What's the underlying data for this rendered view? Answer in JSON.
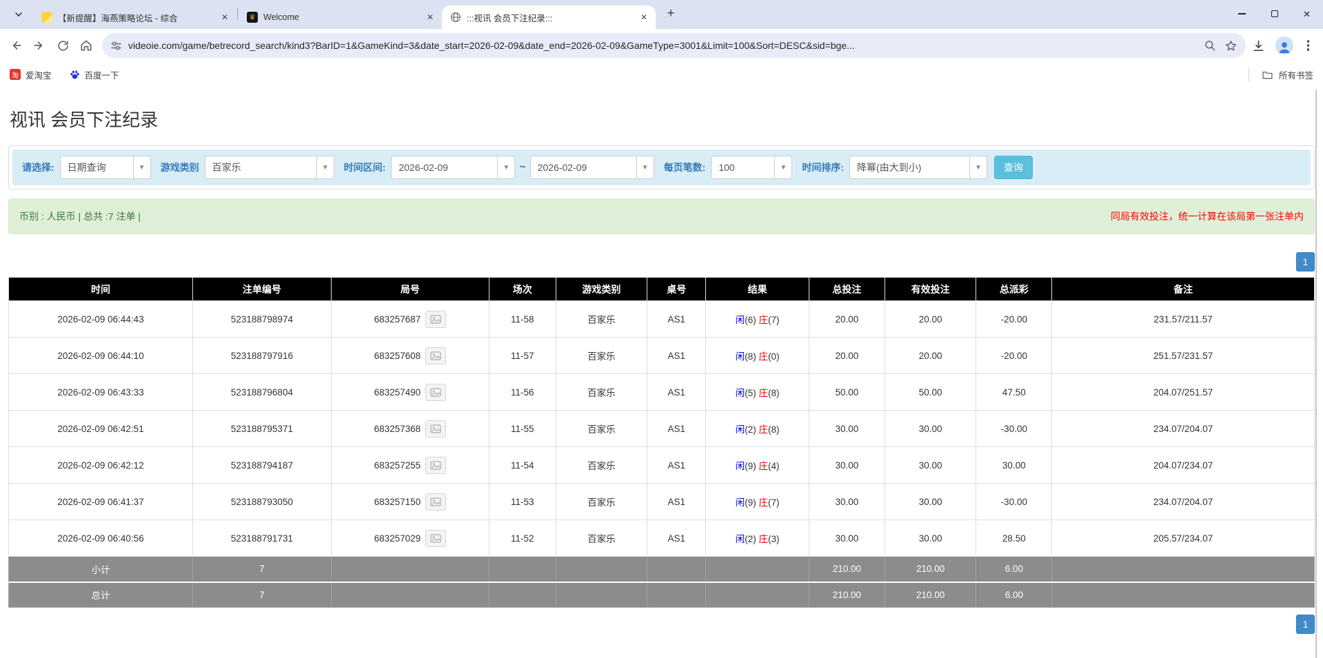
{
  "browser": {
    "tab_search_icon": "chevron-down",
    "tabs": [
      {
        "title": "【新提醒】海燕策略论坛 - 综合",
        "favicon": "yellow-doc"
      },
      {
        "title": "Welcome",
        "favicon": "dark-crest"
      },
      {
        "title": ":::视讯 会员下注纪录:::",
        "favicon": "globe"
      }
    ],
    "window_controls": [
      "minimize",
      "maximize",
      "close"
    ],
    "url": "videoie.com/game/betrecord_search/kind3?BarID=1&GameKind=3&date_start=2026-02-09&date_end=2026-02-09&GameType=3001&Limit=100&Sort=DESC&sid=bge...",
    "omnibox_icons": [
      "tune",
      "zoom",
      "star"
    ],
    "toolbar_icons": [
      "back",
      "forward",
      "reload",
      "home",
      "download",
      "profile",
      "menu"
    ],
    "bookmarks": [
      {
        "label": "爱淘宝",
        "icon": "taobao"
      },
      {
        "label": "百度一下",
        "icon": "baidu-paw"
      }
    ],
    "all_bookmarks_label": "所有书签"
  },
  "page": {
    "title": "视讯 会员下注纪录",
    "filters": {
      "select_label": "请选择:",
      "select_value": "日期查询",
      "game_type_label": "游戏类别",
      "game_type_value": "百家乐",
      "date_range_label": "时间区间:",
      "date_start": "2026-02-09",
      "date_separator": "~",
      "date_end": "2026-02-09",
      "page_size_label": "每页笔数:",
      "page_size_value": "100",
      "sort_label": "时间排序:",
      "sort_value": "降幂(由大到小)",
      "search_button": "查询"
    },
    "summary_bar": {
      "left_text": "币别 : 人民币 | 总共 :7 注单 |",
      "notice": "同局有效投注，统一计算在该局第一张注单内"
    },
    "pagination": {
      "page": "1"
    },
    "colors": {
      "accent_blue": "#337ab7",
      "query_button": "#5bc0de",
      "player_blue": "#0000ee",
      "banker_red": "#e60000",
      "negative_red": "#ff0000",
      "header_black": "#000000",
      "summary_grey": "#8c8c8c"
    },
    "table": {
      "headers": [
        "时间",
        "注单编号",
        "局号",
        "场次",
        "游戏类别",
        "桌号",
        "结果",
        "总投注",
        "有效投注",
        "总派彩",
        "备注"
      ],
      "rows": [
        {
          "time": "2026-02-09 06:44:43",
          "bet_id": "523188798974",
          "round_id": "683257687",
          "session": "11-58",
          "game": "百家乐",
          "table_no": "AS1",
          "xian_label": "闲",
          "xian_score": "(6)",
          "zhuang_label": "庄",
          "zhuang_score": "(7)",
          "total_bet": "20.00",
          "valid_bet": "20.00",
          "payout": "-20.00",
          "payout_class": "neg",
          "remark": "231.57/211.57"
        },
        {
          "time": "2026-02-09 06:44:10",
          "bet_id": "523188797916",
          "round_id": "683257608",
          "session": "11-57",
          "game": "百家乐",
          "table_no": "AS1",
          "xian_label": "闲",
          "xian_score": "(8)",
          "zhuang_label": "庄",
          "zhuang_score": "(0)",
          "total_bet": "20.00",
          "valid_bet": "20.00",
          "payout": "-20.00",
          "payout_class": "neg",
          "remark": "251.57/231.57"
        },
        {
          "time": "2026-02-09 06:43:33",
          "bet_id": "523188796804",
          "round_id": "683257490",
          "session": "11-56",
          "game": "百家乐",
          "table_no": "AS1",
          "xian_label": "闲",
          "xian_score": "(5)",
          "zhuang_label": "庄",
          "zhuang_score": "(8)",
          "total_bet": "50.00",
          "valid_bet": "50.00",
          "payout": "47.50",
          "payout_class": "",
          "remark": "204.07/251.57"
        },
        {
          "time": "2026-02-09 06:42:51",
          "bet_id": "523188795371",
          "round_id": "683257368",
          "session": "11-55",
          "game": "百家乐",
          "table_no": "AS1",
          "xian_label": "闲",
          "xian_score": "(2)",
          "zhuang_label": "庄",
          "zhuang_score": "(8)",
          "total_bet": "30.00",
          "valid_bet": "30.00",
          "payout": "-30.00",
          "payout_class": "neg",
          "remark": "234.07/204.07"
        },
        {
          "time": "2026-02-09 06:42:12",
          "bet_id": "523188794187",
          "round_id": "683257255",
          "session": "11-54",
          "game": "百家乐",
          "table_no": "AS1",
          "xian_label": "闲",
          "xian_score": "(9)",
          "zhuang_label": "庄",
          "zhuang_score": "(4)",
          "total_bet": "30.00",
          "valid_bet": "30.00",
          "payout": "30.00",
          "payout_class": "",
          "remark": "204.07/234.07"
        },
        {
          "time": "2026-02-09 06:41:37",
          "bet_id": "523188793050",
          "round_id": "683257150",
          "session": "11-53",
          "game": "百家乐",
          "table_no": "AS1",
          "xian_label": "闲",
          "xian_score": "(9)",
          "zhuang_label": "庄",
          "zhuang_score": "(7)",
          "total_bet": "30.00",
          "valid_bet": "30.00",
          "payout": "-30.00",
          "payout_class": "neg",
          "remark": "234.07/204.07"
        },
        {
          "time": "2026-02-09 06:40:56",
          "bet_id": "523188791731",
          "round_id": "683257029",
          "session": "11-52",
          "game": "百家乐",
          "table_no": "AS1",
          "xian_label": "闲",
          "xian_score": "(2)",
          "zhuang_label": "庄",
          "zhuang_score": "(3)",
          "total_bet": "30.00",
          "valid_bet": "30.00",
          "payout": "28.50",
          "payout_class": "",
          "remark": "205.57/234.07"
        }
      ],
      "subtotal": {
        "label": "小计",
        "count": "7",
        "total_bet": "210.00",
        "valid_bet": "210.00",
        "payout": "6.00"
      },
      "total": {
        "label": "总计",
        "count": "7",
        "total_bet": "210.00",
        "valid_bet": "210.00",
        "payout": "6.00"
      }
    }
  }
}
